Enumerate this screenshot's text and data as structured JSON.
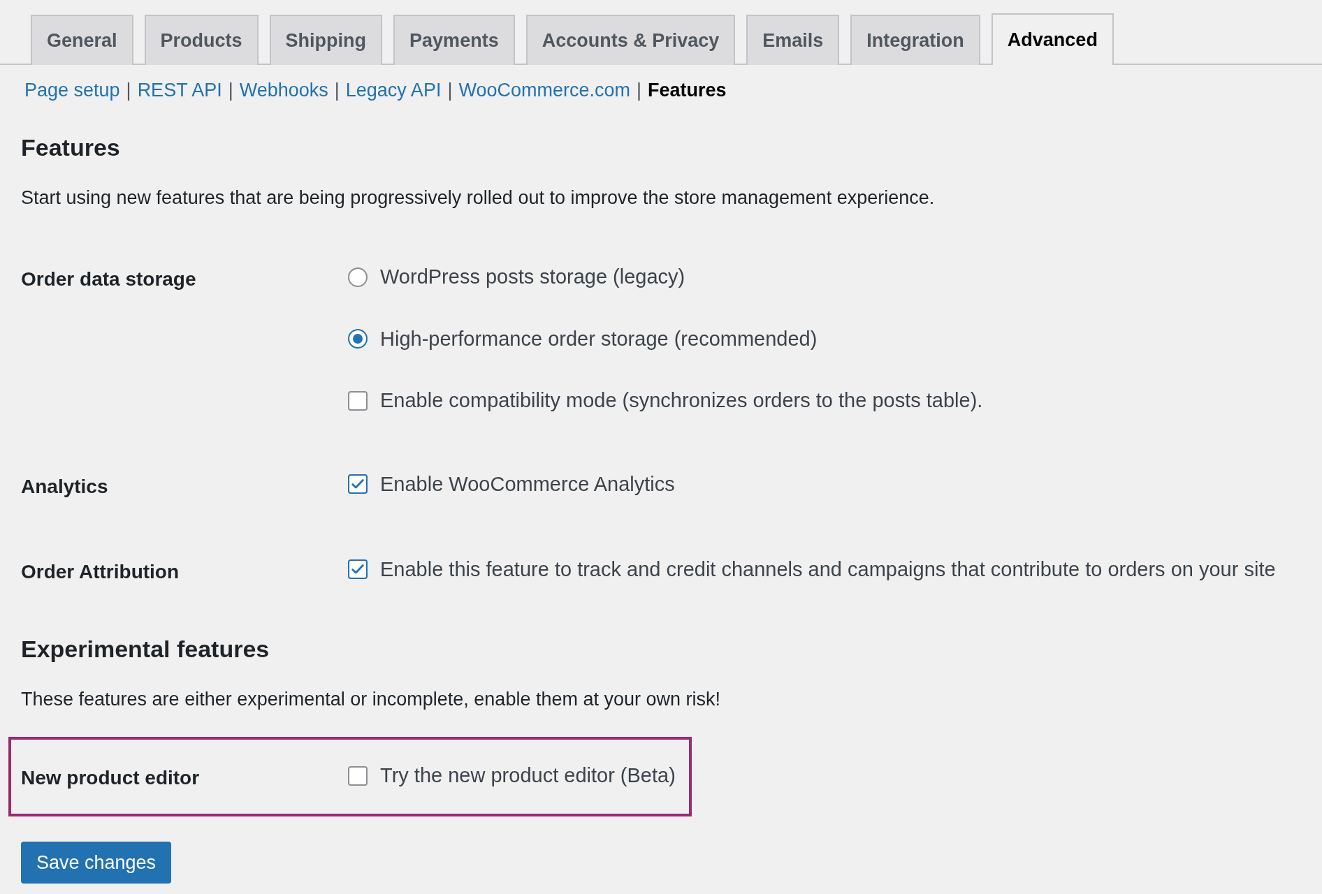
{
  "tabs": [
    {
      "label": "General",
      "selected": false
    },
    {
      "label": "Products",
      "selected": false
    },
    {
      "label": "Shipping",
      "selected": false
    },
    {
      "label": "Payments",
      "selected": false
    },
    {
      "label": "Accounts & Privacy",
      "selected": false
    },
    {
      "label": "Emails",
      "selected": false
    },
    {
      "label": "Integration",
      "selected": false
    },
    {
      "label": "Advanced",
      "selected": true
    }
  ],
  "subnav": [
    {
      "kind": "link",
      "label": "Page setup",
      "selected": false
    },
    {
      "kind": "separator",
      "label": "|"
    },
    {
      "kind": "link",
      "label": "REST API",
      "selected": false
    },
    {
      "kind": "separator",
      "label": "|"
    },
    {
      "kind": "link",
      "label": "Webhooks",
      "selected": false
    },
    {
      "kind": "separator",
      "label": "|"
    },
    {
      "kind": "link",
      "label": "Legacy API",
      "selected": false
    },
    {
      "kind": "separator",
      "label": "|"
    },
    {
      "kind": "link",
      "label": "WooCommerce.com",
      "selected": false
    },
    {
      "kind": "separator",
      "label": "|"
    },
    {
      "kind": "link",
      "label": "Features",
      "selected": true
    }
  ],
  "sections": [
    {
      "title": "Features",
      "description": "Start using new features that are being progressively rolled out to improve the store management experience.",
      "rows": [
        {
          "label": "Order data storage",
          "highlighted": false,
          "options": [
            {
              "kind": "radio",
              "label": "WordPress posts storage (legacy)",
              "checked": false
            },
            {
              "kind": "radio",
              "label": "High-performance order storage (recommended)",
              "checked": true
            },
            {
              "kind": "checkbox",
              "label": "Enable compatibility mode (synchronizes orders to the posts table).",
              "checked": false
            }
          ]
        },
        {
          "label": "Analytics",
          "highlighted": false,
          "options": [
            {
              "kind": "checkbox",
              "label": "Enable WooCommerce Analytics",
              "checked": true
            }
          ]
        },
        {
          "label": "Order Attribution",
          "highlighted": false,
          "options": [
            {
              "kind": "checkbox",
              "label": "Enable this feature to track and credit channels and campaigns that contribute to orders on your site",
              "checked": true
            }
          ]
        }
      ]
    },
    {
      "title": "Experimental features",
      "description": "These features are either experimental or incomplete, enable them at your own risk!",
      "rows": [
        {
          "label": "New product editor",
          "highlighted": true,
          "options": [
            {
              "kind": "checkbox",
              "label": "Try the new product editor (Beta)",
              "checked": false
            }
          ]
        }
      ]
    }
  ],
  "save_button": "Save changes"
}
